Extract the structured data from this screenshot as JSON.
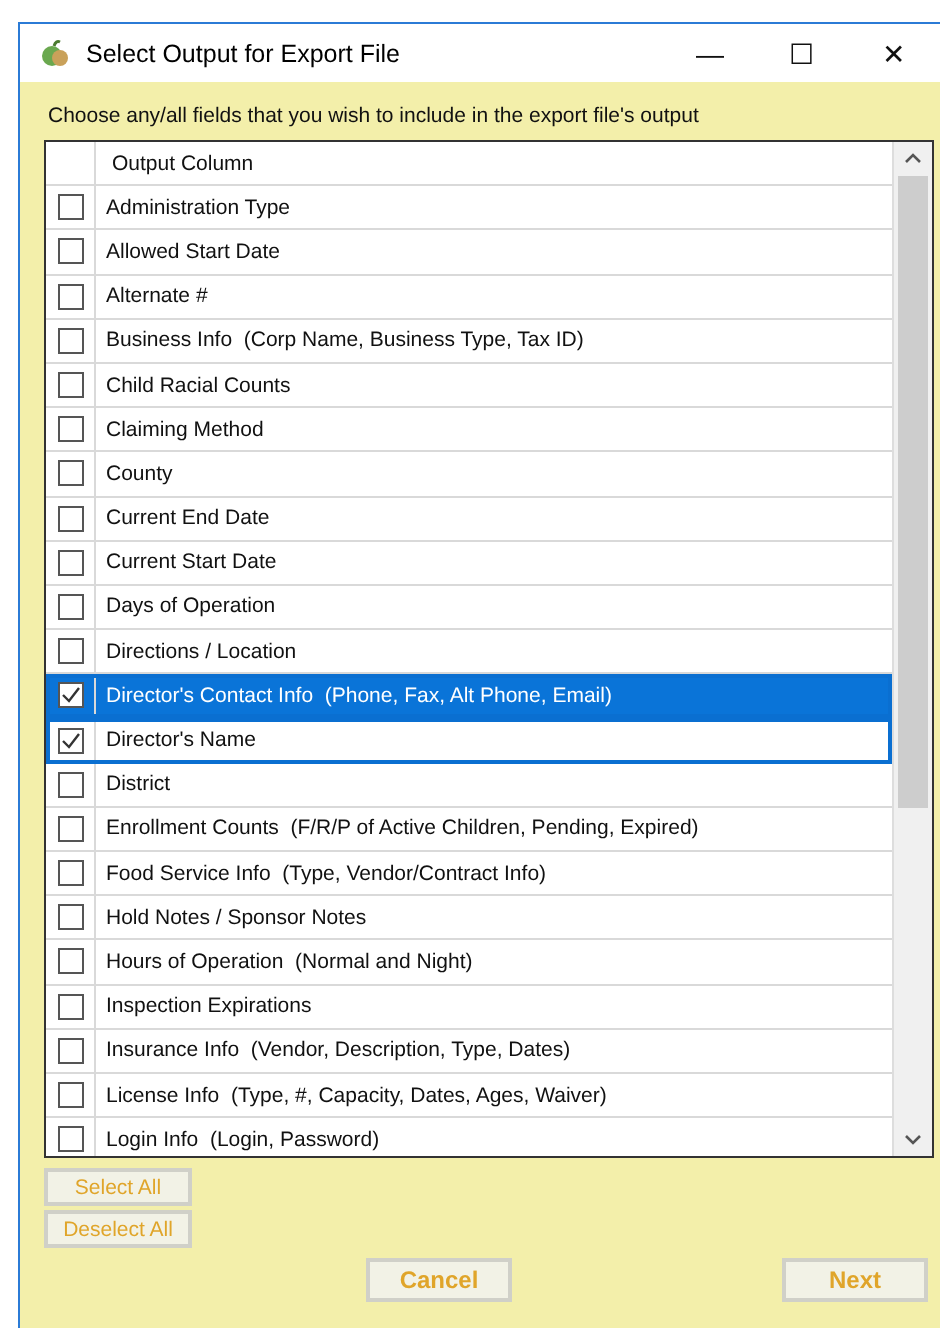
{
  "window": {
    "title": "Select Output for Export File",
    "controls": [
      "—",
      "☐",
      "✕"
    ]
  },
  "instruction": "Choose any/all fields that you wish to include in the export file's output",
  "table": {
    "columns": [
      "Output Column"
    ],
    "rows": [
      {
        "label": "Administration Type",
        "checked": false,
        "selected": false,
        "focused": false
      },
      {
        "label": "Allowed Start Date",
        "checked": false,
        "selected": false,
        "focused": false
      },
      {
        "label": "Alternate #",
        "checked": false,
        "selected": false,
        "focused": false
      },
      {
        "label": "Business Info  (Corp Name, Business Type, Tax ID)",
        "checked": false,
        "selected": false,
        "focused": false
      },
      {
        "label": "Child Racial Counts",
        "checked": false,
        "selected": false,
        "focused": false
      },
      {
        "label": "Claiming Method",
        "checked": false,
        "selected": false,
        "focused": false
      },
      {
        "label": "County",
        "checked": false,
        "selected": false,
        "focused": false
      },
      {
        "label": "Current End Date",
        "checked": false,
        "selected": false,
        "focused": false
      },
      {
        "label": "Current Start Date",
        "checked": false,
        "selected": false,
        "focused": false
      },
      {
        "label": "Days of Operation",
        "checked": false,
        "selected": false,
        "focused": false
      },
      {
        "label": "Directions / Location",
        "checked": false,
        "selected": false,
        "focused": false
      },
      {
        "label": "Director's Contact Info  (Phone, Fax, Alt Phone, Email)",
        "checked": true,
        "selected": true,
        "focused": true
      },
      {
        "label": "Director's Name",
        "checked": true,
        "selected": true,
        "focused": false
      },
      {
        "label": "District",
        "checked": false,
        "selected": false,
        "focused": false
      },
      {
        "label": "Enrollment Counts  (F/R/P of Active Children, Pending, Expired)",
        "checked": false,
        "selected": false,
        "focused": false
      },
      {
        "label": "Food Service Info  (Type, Vendor/Contract Info)",
        "checked": false,
        "selected": false,
        "focused": false
      },
      {
        "label": "Hold Notes / Sponsor Notes",
        "checked": false,
        "selected": false,
        "focused": false
      },
      {
        "label": "Hours of Operation  (Normal and Night)",
        "checked": false,
        "selected": false,
        "focused": false
      },
      {
        "label": "Inspection Expirations",
        "checked": false,
        "selected": false,
        "focused": false
      },
      {
        "label": "Insurance Info  (Vendor, Description, Type, Dates)",
        "checked": false,
        "selected": false,
        "focused": false
      },
      {
        "label": "License Info  (Type, #, Capacity, Dates, Ages, Waiver)",
        "checked": false,
        "selected": false,
        "focused": false
      },
      {
        "label": "Login Info  (Login, Password)",
        "checked": false,
        "selected": false,
        "focused": false
      }
    ]
  },
  "buttons": {
    "select_all": "Select All",
    "deselect_all": "Deselect All",
    "cancel": "Cancel",
    "next": "Next"
  }
}
